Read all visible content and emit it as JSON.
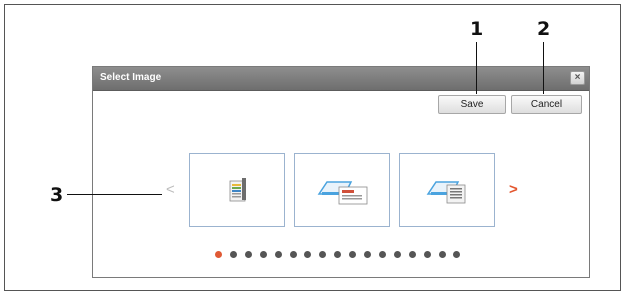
{
  "dialog": {
    "title": "Select Image",
    "close_label": "×",
    "save_label": "Save",
    "cancel_label": "Cancel"
  },
  "carousel": {
    "prev_label": "<",
    "next_label": ">",
    "thumbnails": [
      {
        "icon": "document-icon"
      },
      {
        "icon": "scan-to-card-icon"
      },
      {
        "icon": "scan-to-document-icon"
      }
    ],
    "page_count": 17,
    "active_page": 1
  },
  "callouts": [
    {
      "label": "1"
    },
    {
      "label": "2"
    },
    {
      "label": "3"
    }
  ]
}
